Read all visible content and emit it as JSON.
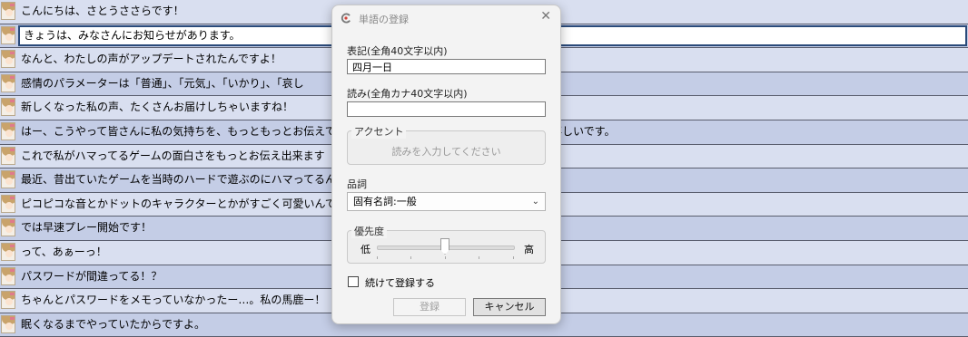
{
  "lines": [
    {
      "text": "こんにちは、さとうささらです！"
    },
    {
      "text": "きょうは、みなさんにお知らせがあります。",
      "selected": true
    },
    {
      "text": "なんと、わたしの声がアップデートされたんですよ！"
    },
    {
      "text": "感情のパラメーターは「普通」、「元気」、「いかり」、「哀し"
    },
    {
      "text": "新しくなった私の声、たくさんお届けしちゃいますね！"
    },
    {
      "text": "はー、こうやって皆さんに私の気持ちを、もっともっとお伝えできるようになったんだって思うと、とっても嬉しいです。"
    },
    {
      "text": "これで私がハマってるゲームの面白さをもっとお伝え出来ます"
    },
    {
      "text": "最近、昔出ていたゲームを当時のハードで遊ぶのにハマってるんです"
    },
    {
      "text": "ピコピコな音とかドットのキャラクターとかがすごく可愛いんです"
    },
    {
      "text": "では早速プレー開始です！"
    },
    {
      "text": "って、あぁーっ！"
    },
    {
      "text": "パスワードが間違ってる！？"
    },
    {
      "text": "ちゃんとパスワードをメモっていなかったー…。私の馬鹿ー！"
    },
    {
      "text": "眠くなるまでやっていたからですよ。"
    }
  ],
  "dialog": {
    "title": "単語の登録",
    "close_glyph": "✕",
    "notation_label": "表記(全角40文字以内)",
    "notation_value": "四月一日",
    "reading_label": "読み(全角カナ40文字以内)",
    "reading_value": "",
    "accent_label": "アクセント",
    "accent_placeholder": "読みを入力してください",
    "pos_label": "品詞",
    "pos_value": "固有名詞:一般",
    "priority_label": "優先度",
    "priority_low": "低",
    "priority_high": "高",
    "priority_level": 0.5,
    "continue_label": "続けて登録する",
    "continue_checked": false,
    "register_button": "登録",
    "cancel_button": "キャンセル"
  },
  "colors": {
    "row_odd": "#d9dff0",
    "row_even": "#c4cde6",
    "selected_border": "#2a4a7a",
    "app_icon_red": "#d0453b"
  },
  "icons": {
    "app": "app-logo-icon",
    "close": "close-icon",
    "dropdown": "chevron-down-icon",
    "avatar": "character-avatar-icon"
  }
}
